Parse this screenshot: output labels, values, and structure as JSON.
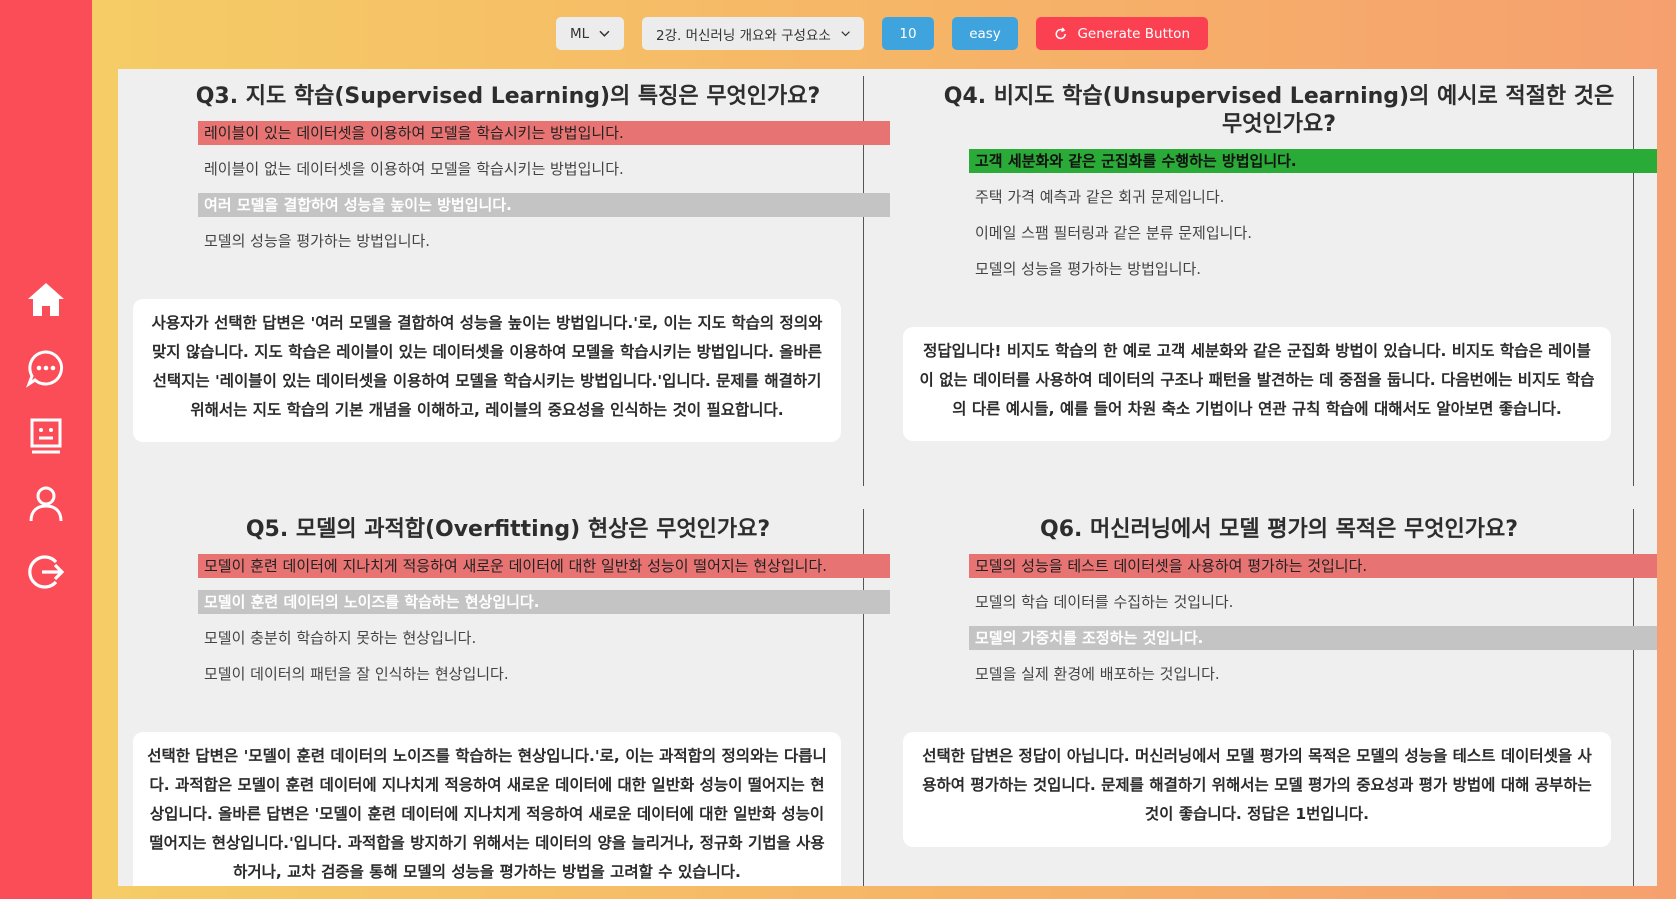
{
  "sidebar": {
    "items": [
      {
        "icon": "home-icon",
        "label": "home"
      },
      {
        "icon": "chat-icon",
        "label": "chat"
      },
      {
        "icon": "quiz-icon",
        "label": "quiz"
      },
      {
        "icon": "user-icon",
        "label": "profile"
      },
      {
        "icon": "logout-icon",
        "label": "logout"
      }
    ]
  },
  "toolbar": {
    "subject": "ML",
    "lecture": "2강. 머신러닝 개요와 구성요소",
    "count": "10",
    "difficulty": "easy",
    "generate_label": "Generate Button"
  },
  "colors": {
    "sidebar": "#fb4d57",
    "wrong": "#e87373",
    "correct": "#2aab37",
    "picked": "#c4c4c4",
    "pill": "#3fa4dd",
    "generate": "#fb4052"
  },
  "questions": [
    {
      "title": "Q3. 지도 학습(Supervised Learning)의 특징은 무엇인가요?",
      "options": [
        {
          "text": "레이블이 있는 데이터셋을 이용하여 모델을 학습시키는 방법입니다.",
          "state": "wrong"
        },
        {
          "text": "레이블이 없는 데이터셋을 이용하여 모델을 학습시키는 방법입니다.",
          "state": "normal"
        },
        {
          "text": "여러 모델을 결합하여 성능을 높이는 방법입니다.",
          "state": "picked"
        },
        {
          "text": "모델의 성능을 평가하는 방법입니다.",
          "state": "normal"
        }
      ],
      "feedback": "사용자가 선택한 답변은 '여러 모델을 결합하여 성능을 높이는 방법입니다.'로, 이는 지도 학습의 정의와 맞지 않습니다. 지도 학습은 레이블이 있는 데이터셋을 이용하여 모델을 학습시키는 방법입니다. 올바른 선택지는 '레이블이 있는 데이터셋을 이용하여 모델을 학습시키는 방법입니다.'입니다. 문제를 해결하기 위해서는 지도 학습의 기본 개념을 이해하고, 레이블의 중요성을 인식하는 것이 필요합니다."
    },
    {
      "title": "Q4. 비지도 학습(Unsupervised Learning)의 예시로 적절한 것은 무엇인가요?",
      "options": [
        {
          "text": "고객 세분화와 같은 군집화를 수행하는 방법입니다.",
          "state": "correct"
        },
        {
          "text": "주택 가격 예측과 같은 회귀 문제입니다.",
          "state": "normal"
        },
        {
          "text": "이메일 스팸 필터링과 같은 분류 문제입니다.",
          "state": "normal"
        },
        {
          "text": "모델의 성능을 평가하는 방법입니다.",
          "state": "normal"
        }
      ],
      "feedback": "정답입니다! 비지도 학습의 한 예로 고객 세분화와 같은 군집화 방법이 있습니다. 비지도 학습은 레이블이 없는 데이터를 사용하여 데이터의 구조나 패턴을 발견하는 데 중점을 둡니다. 다음번에는 비지도 학습의 다른 예시들, 예를 들어 차원 축소 기법이나 연관 규칙 학습에 대해서도 알아보면 좋습니다."
    },
    {
      "title": "Q5. 모델의 과적합(Overfitting) 현상은 무엇인가요?",
      "options": [
        {
          "text": "모델이 훈련 데이터에 지나치게 적응하여 새로운 데이터에 대한 일반화 성능이 떨어지는 현상입니다.",
          "state": "wrong"
        },
        {
          "text": "모델이 훈련 데이터의 노이즈를 학습하는 현상입니다.",
          "state": "picked"
        },
        {
          "text": "모델이 충분히 학습하지 못하는 현상입니다.",
          "state": "normal"
        },
        {
          "text": "모델이 데이터의 패턴을 잘 인식하는 현상입니다.",
          "state": "normal"
        }
      ],
      "feedback": "선택한 답변은 '모델이 훈련 데이터의 노이즈를 학습하는 현상입니다.'로, 이는 과적합의 정의와는 다릅니다. 과적합은 모델이 훈련 데이터에 지나치게 적응하여 새로운 데이터에 대한 일반화 성능이 떨어지는 현상입니다. 올바른 답변은 '모델이 훈련 데이터에 지나치게 적응하여 새로운 데이터에 대한 일반화 성능이 떨어지는 현상입니다.'입니다. 과적합을 방지하기 위해서는 데이터의 양을 늘리거나, 정규화 기법을 사용하거나, 교차 검증을 통해 모델의 성능을 평가하는 방법을 고려할 수 있습니다."
    },
    {
      "title": "Q6. 머신러닝에서 모델 평가의 목적은 무엇인가요?",
      "options": [
        {
          "text": "모델의 성능을 테스트 데이터셋을 사용하여 평가하는 것입니다.",
          "state": "wrong"
        },
        {
          "text": "모델의 학습 데이터를 수집하는 것입니다.",
          "state": "normal"
        },
        {
          "text": "모델의 가중치를 조정하는 것입니다.",
          "state": "picked"
        },
        {
          "text": "모델을 실제 환경에 배포하는 것입니다.",
          "state": "normal"
        }
      ],
      "feedback": "선택한 답변은 정답이 아닙니다. 머신러닝에서 모델 평가의 목적은 모델의 성능을 테스트 데이터셋을 사용하여 평가하는 것입니다. 문제를 해결하기 위해서는 모델 평가의 중요성과 평가 방법에 대해 공부하는 것이 좋습니다. 정답은 1번입니다."
    }
  ]
}
